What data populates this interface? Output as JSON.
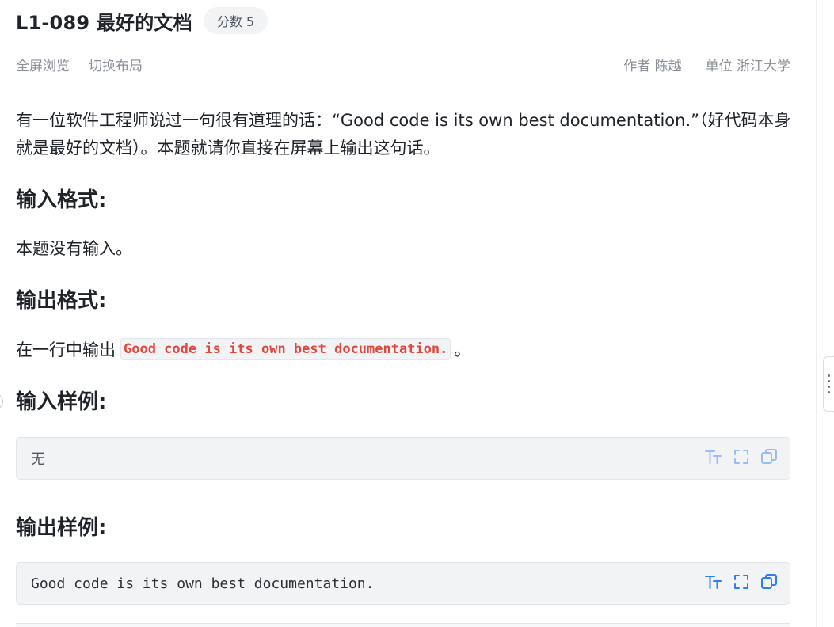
{
  "problem": {
    "title": "L1-089 最好的文档",
    "score_label": "分数 5"
  },
  "toolbar": {
    "fullscreen_label": "全屏浏览",
    "switch_layout_label": "切换布局",
    "author_label": "作者 陈越",
    "org_label": "单位 浙江大学"
  },
  "description": "有一位软件工程师说过一句很有道理的话：“Good code is its own best documentation.”（好代码本身就是最好的文档）。本题就请你直接在屏幕上输出这句话。",
  "input_format": {
    "heading": "输入格式:",
    "text": "本题没有输入。"
  },
  "output_format": {
    "heading": "输出格式:",
    "prefix": "在一行中输出",
    "code": "Good code is its own best documentation.",
    "suffix": "。"
  },
  "sample_input": {
    "heading": "输入样例:",
    "content": "无"
  },
  "sample_output": {
    "heading": "输出样例:",
    "content": "Good code is its own best documentation."
  },
  "icons": {
    "font_size": "font-size-icon",
    "fullscreen": "fullscreen-icon",
    "copy": "copy-icon"
  },
  "colors": {
    "accent": "#2f7bf5",
    "inline_code": "#e0473f",
    "muted_text": "#8a8f98"
  }
}
